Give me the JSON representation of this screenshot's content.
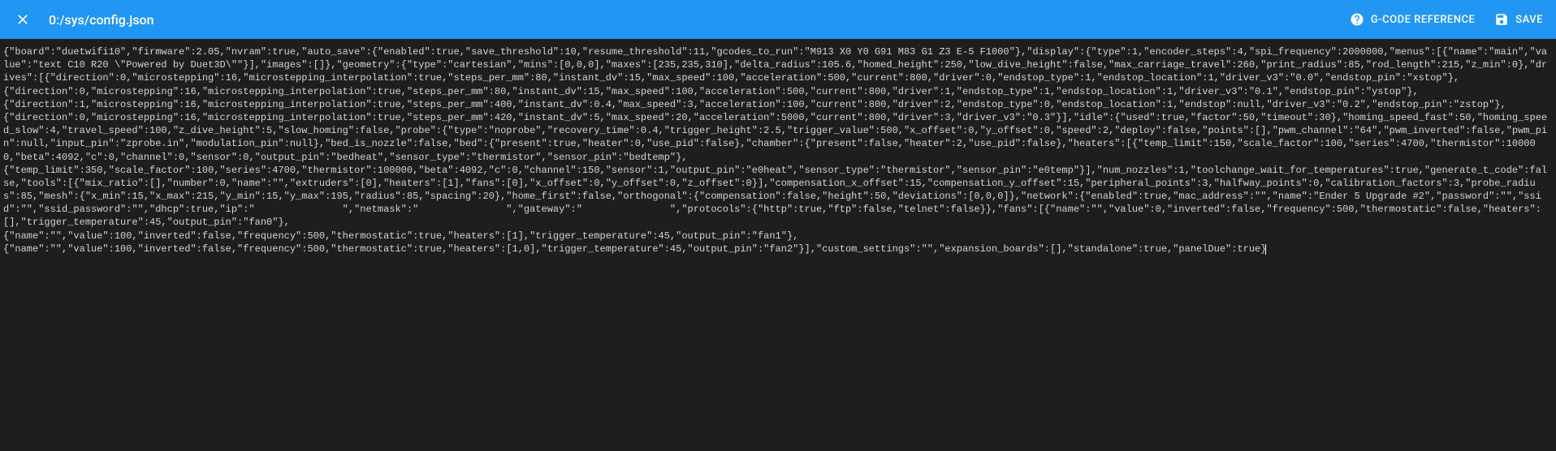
{
  "header": {
    "title": "0:/sys/config.json",
    "reference_label": "G-CODE REFERENCE",
    "save_label": "SAVE"
  },
  "editor": {
    "content": "{\"board\":\"duetwifi10\",\"firmware\":2.05,\"nvram\":true,\"auto_save\":{\"enabled\":true,\"save_threshold\":10,\"resume_threshold\":11,\"gcodes_to_run\":\"M913 X0 Y0 G91 M83 G1 Z3 E-5 F1000\"},\"display\":{\"type\":1,\"encoder_steps\":4,\"spi_frequency\":2000000,\"menus\":[{\"name\":\"main\",\"value\":\"text C10 R20 \\\"Powered by Duet3D\\\"\"}],\"images\":[]},\"geometry\":{\"type\":\"cartesian\",\"mins\":[0,0,0],\"maxes\":[235,235,310],\"delta_radius\":105.6,\"homed_height\":250,\"low_dive_height\":false,\"max_carriage_travel\":260,\"print_radius\":85,\"rod_length\":215,\"z_min\":0},\"drives\":[{\"direction\":0,\"microstepping\":16,\"microstepping_interpolation\":true,\"steps_per_mm\":80,\"instant_dv\":15,\"max_speed\":100,\"acceleration\":500,\"current\":800,\"driver\":0,\"endstop_type\":1,\"endstop_location\":1,\"driver_v3\":\"0.0\",\"endstop_pin\":\"xstop\"},\n{\"direction\":0,\"microstepping\":16,\"microstepping_interpolation\":true,\"steps_per_mm\":80,\"instant_dv\":15,\"max_speed\":100,\"acceleration\":500,\"current\":800,\"driver\":1,\"endstop_type\":1,\"endstop_location\":1,\"driver_v3\":\"0.1\",\"endstop_pin\":\"ystop\"},\n{\"direction\":1,\"microstepping\":16,\"microstepping_interpolation\":true,\"steps_per_mm\":400,\"instant_dv\":0.4,\"max_speed\":3,\"acceleration\":100,\"current\":800,\"driver\":2,\"endstop_type\":0,\"endstop_location\":1,\"endstop\":null,\"driver_v3\":\"0.2\",\"endstop_pin\":\"zstop\"},\n{\"direction\":0,\"microstepping\":16,\"microstepping_interpolation\":true,\"steps_per_mm\":420,\"instant_dv\":5,\"max_speed\":20,\"acceleration\":5000,\"current\":800,\"driver\":3,\"driver_v3\":\"0.3\"}],\"idle\":{\"used\":true,\"factor\":50,\"timeout\":30},\"homing_speed_fast\":50,\"homing_speed_slow\":4,\"travel_speed\":100,\"z_dive_height\":5,\"slow_homing\":false,\"probe\":{\"type\":\"noprobe\",\"recovery_time\":0.4,\"trigger_height\":2.5,\"trigger_value\":500,\"x_offset\":0,\"y_offset\":0,\"speed\":2,\"deploy\":false,\"points\":[],\"pwm_channel\":\"64\",\"pwm_inverted\":false,\"pwm_pin\":null,\"input_pin\":\"zprobe.in\",\"modulation_pin\":null},\"bed_is_nozzle\":false,\"bed\":{\"present\":true,\"heater\":0,\"use_pid\":false},\"chamber\":{\"present\":false,\"heater\":2,\"use_pid\":false},\"heaters\":[{\"temp_limit\":150,\"scale_factor\":100,\"series\":4700,\"thermistor\":100000,\"beta\":4092,\"c\":0,\"channel\":0,\"sensor\":0,\"output_pin\":\"bedheat\",\"sensor_type\":\"thermistor\",\"sensor_pin\":\"bedtemp\"},\n{\"temp_limit\":350,\"scale_factor\":100,\"series\":4700,\"thermistor\":100000,\"beta\":4092,\"c\":0,\"channel\":150,\"sensor\":1,\"output_pin\":\"e0heat\",\"sensor_type\":\"thermistor\",\"sensor_pin\":\"e0temp\"}],\"num_nozzles\":1,\"toolchange_wait_for_temperatures\":true,\"generate_t_code\":false,\"tools\":[{\"mix_ratio\":[],\"number\":0,\"name\":\"\",\"extruders\":[0],\"heaters\":[1],\"fans\":[0],\"x_offset\":0,\"y_offset\":0,\"z_offset\":0}],\"compensation_x_offset\":15,\"compensation_y_offset\":15,\"peripheral_points\":3,\"halfway_points\":0,\"calibration_factors\":3,\"probe_radius\":85,\"mesh\":{\"x_min\":15,\"x_max\":215,\"y_min\":15,\"y_max\":195,\"radius\":85,\"spacing\":20},\"home_first\":false,\"orthogonal\":{\"compensation\":false,\"height\":50,\"deviations\":[0,0,0]},\"network\":{\"enabled\":true,\"mac_address\":\"\",\"name\":\"Ender 5 Upgrade #2\",\"password\":\"\",\"ssid\":\"\",\"ssid_password\":\"\",\"dhcp\":true,\"ip\":\"               \",\"netmask\":\"               \",\"gateway\":\"               \",\"protocols\":{\"http\":true,\"ftp\":false,\"telnet\":false}},\"fans\":[{\"name\":\"\",\"value\":0,\"inverted\":false,\"frequency\":500,\"thermostatic\":false,\"heaters\":[],\"trigger_temperature\":45,\"output_pin\":\"fan0\"},\n{\"name\":\"\",\"value\":100,\"inverted\":false,\"frequency\":500,\"thermostatic\":true,\"heaters\":[1],\"trigger_temperature\":45,\"output_pin\":\"fan1\"},\n{\"name\":\"\",\"value\":100,\"inverted\":false,\"frequency\":500,\"thermostatic\":true,\"heaters\":[1,0],\"trigger_temperature\":45,\"output_pin\":\"fan2\"}],\"custom_settings\":\"\",\"expansion_boards\":[],\"standalone\":true,\"panelDue\":true}"
  }
}
